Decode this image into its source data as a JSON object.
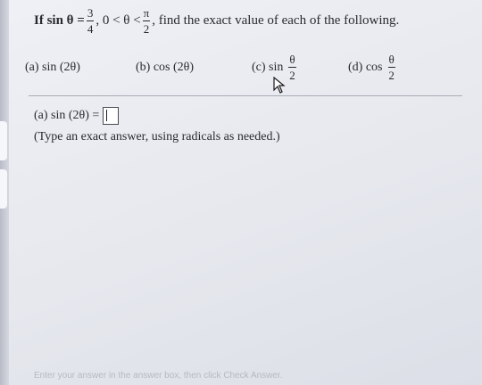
{
  "problem": {
    "prefix": "If sin θ =",
    "sin_num": "3",
    "sin_den": "4",
    "range_text": ", 0 < θ <",
    "range_num": "π",
    "range_den": "2",
    "suffix": ", find the exact value of each of the following."
  },
  "parts": [
    {
      "label": "(a) sin (2θ)"
    },
    {
      "label": "(b) cos (2θ)"
    },
    {
      "label": "(c) sin",
      "num": "θ",
      "den": "2"
    },
    {
      "label": "(d) cos",
      "num": "θ",
      "den": "2"
    }
  ],
  "answer": {
    "label": "(a) sin (2θ) =",
    "value": ""
  },
  "hint": "(Type an exact answer, using radicals as needed.)",
  "footer": "Enter your answer in the answer box, then click Check Answer."
}
